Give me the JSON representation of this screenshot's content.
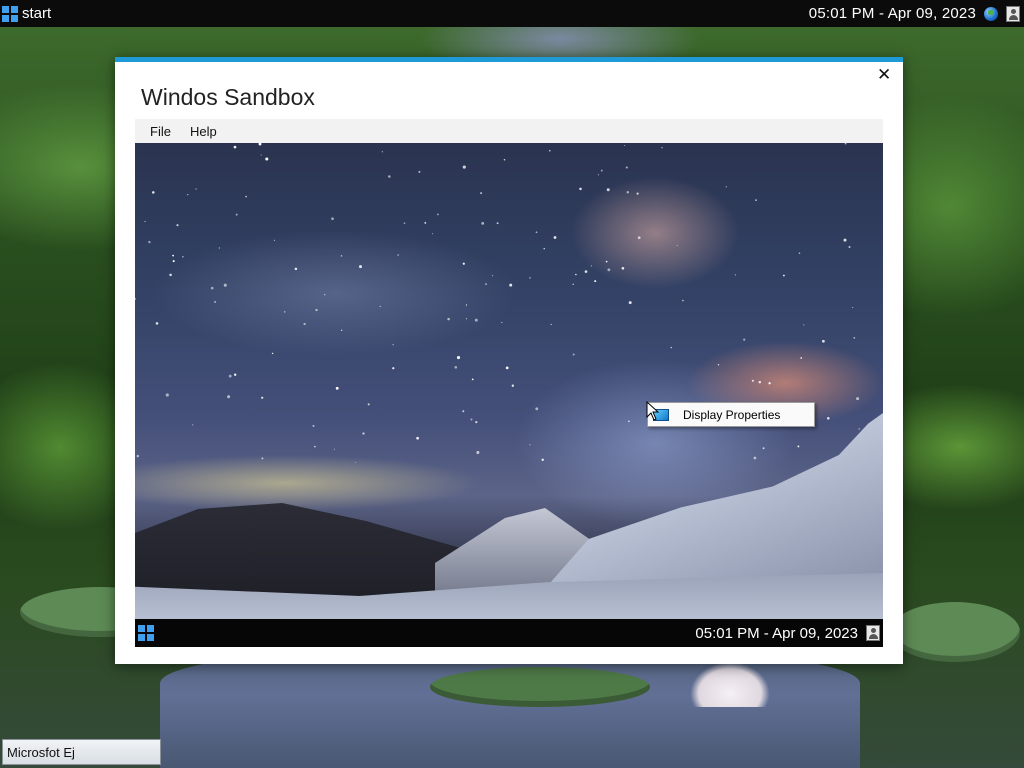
{
  "host_taskbar": {
    "start_label": "start",
    "clock": "05:01 PM - Apr 09, 2023",
    "icons": [
      "windows-logo-icon",
      "globe-icon",
      "user-icon"
    ]
  },
  "window": {
    "title": "Windos Sandbox",
    "close_glyph": "✕",
    "accent_color": "#1e9bd7",
    "menu": [
      {
        "label": "File"
      },
      {
        "label": "Help"
      }
    ]
  },
  "guest": {
    "taskbar": {
      "clock": "05:01 PM - Apr 09, 2023",
      "icons": [
        "windows-logo-icon",
        "user-icon"
      ]
    },
    "context_menu": {
      "items": [
        {
          "label": "Display Properties",
          "icon": "monitor-icon"
        }
      ]
    }
  },
  "host_task_chip": {
    "label": "Microsfot Ej"
  }
}
